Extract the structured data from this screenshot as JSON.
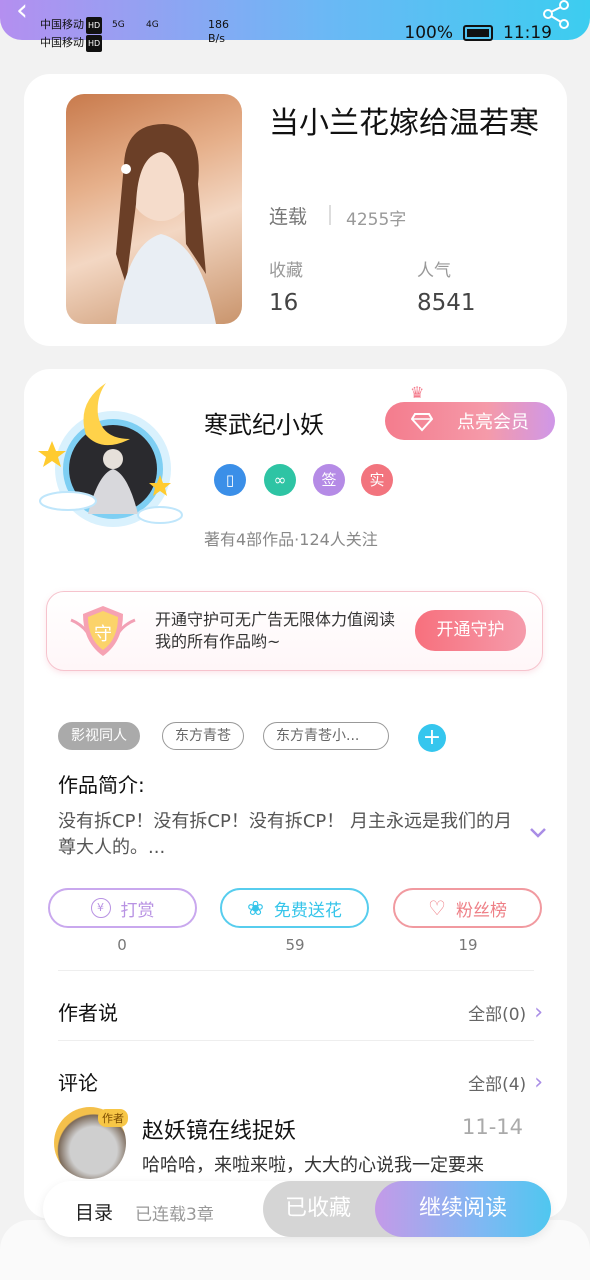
{
  "status_bar": {
    "carrier1": "中国移动",
    "carrier2": "中国移动",
    "hd": "HD",
    "net1": "5G",
    "net2": "4G",
    "speed_value": "186",
    "speed_unit": "B/s",
    "battery": "100%",
    "time": "11:19"
  },
  "book": {
    "title": "当小兰花嫁给温若寒",
    "status": "连载",
    "words": "4255字",
    "fav_label": "收藏",
    "fav_value": "16",
    "pop_label": "人气",
    "pop_value": "8541"
  },
  "author": {
    "name": "寒武纪小妖",
    "vip_button": "点亮会员",
    "badges": [
      {
        "icon": "phone-icon",
        "text": "",
        "color": "#3b8fe8"
      },
      {
        "icon": "handshake-icon",
        "text": "",
        "color": "#2ec4a4"
      },
      {
        "icon": "sign-icon",
        "text": "签",
        "color": "#b58be6"
      },
      {
        "icon": "real-name-icon",
        "text": "实",
        "color": "#f2747e"
      }
    ],
    "meta": "著有4部作品·124人关注"
  },
  "guard": {
    "badge": "守",
    "text": "开通守护可无广告无限体力值阅读我的所有作品哟~",
    "button": "开通守护"
  },
  "tags": [
    "影视同人",
    "东方青苍",
    "东方青苍小..."
  ],
  "intro": {
    "heading": "作品简介:",
    "text": "没有拆CP！没有拆CP！没有拆CP！ 月主永远是我们的月尊大人的。..."
  },
  "actions": [
    {
      "label": "打赏",
      "count": "0",
      "color": "#b892e3"
    },
    {
      "label": "免费送花",
      "count": "59",
      "color": "#36c5ea"
    },
    {
      "label": "粉丝榜",
      "count": "19",
      "color": "#ee7f86"
    }
  ],
  "author_says": {
    "title": "作者说",
    "link": "全部(0)"
  },
  "comments": {
    "title": "评论",
    "link": "全部(4)",
    "first": {
      "badge": "作者",
      "name": "赵妖镜在线捉妖",
      "date": "11-14",
      "text": "哈哈哈，来啦来啦，大大的心说我一定要来"
    }
  },
  "bottom": {
    "toc": "目录",
    "toc_sub": "已连载3章",
    "fav": "已收藏",
    "read": "继续阅读"
  }
}
